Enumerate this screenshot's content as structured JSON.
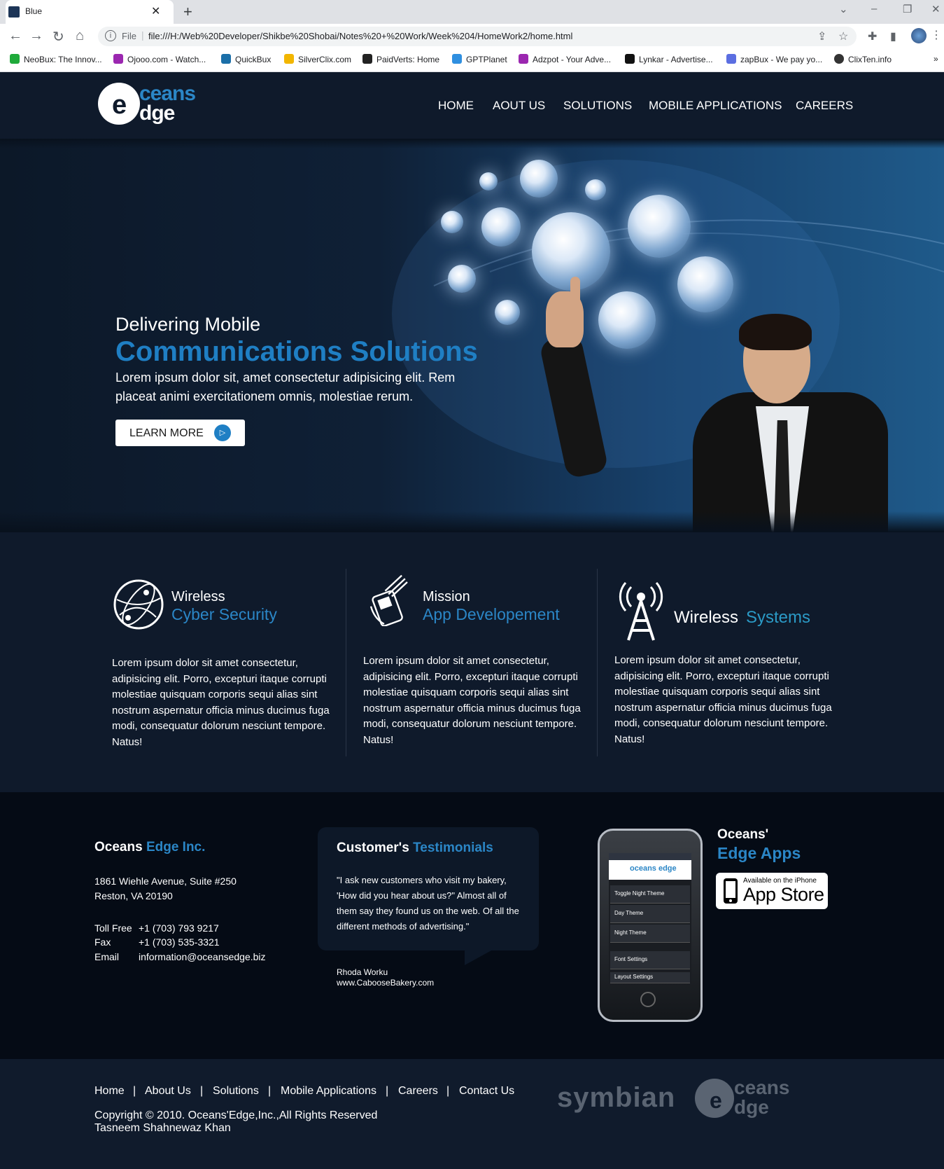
{
  "browser": {
    "tab_title": "Blue",
    "tab_close": "✕",
    "new_tab": "+",
    "url_scheme": "File",
    "url": "file:///H:/Web%20Developer/Shikbe%20Shobai/Notes%20+%20Work/Week%204/HomeWork2/home.html",
    "bookmarks": [
      {
        "label": "NeoBux: The Innov...",
        "color": "#1faa3a"
      },
      {
        "label": "Ojooo.com - Watch...",
        "color": "#9b27b0"
      },
      {
        "label": "QuickBux",
        "color": "#1b6fa8"
      },
      {
        "label": "SilverClix.com",
        "color": "#f2b600"
      },
      {
        "label": "PaidVerts: Home",
        "color": "#222222"
      },
      {
        "label": "GPTPlanet",
        "color": "#2f8fe0"
      },
      {
        "label": "Adzpot - Your Adve...",
        "color": "#9b27b0"
      },
      {
        "label": "Lynkar - Advertise...",
        "color": "#111111"
      },
      {
        "label": "zapBux - We pay yo...",
        "color": "#5b6ee1"
      },
      {
        "label": "ClixTen.info",
        "color": "#333333"
      }
    ],
    "more": "»"
  },
  "logo": {
    "e": "e",
    "oceans": "ceans",
    "edge": "dge"
  },
  "nav": [
    "HOME",
    "AOUT US",
    "SOLUTIONS",
    "MOBILE APPLICATIONS",
    "CAREERS"
  ],
  "hero": {
    "small": "Delivering Mobile",
    "big": "Communications Solutions",
    "body": "Lorem ipsum dolor sit, amet consectetur adipisicing elit. Rem placeat animi exercitationem omnis, molestiae rerum.",
    "button": "LEARN MORE",
    "button_icon": "▷"
  },
  "features": [
    {
      "h1": "Wireless",
      "h2": "Cyber Security",
      "icon": "globe-icon",
      "body": "Lorem ipsum dolor sit amet consectetur, adipisicing elit. Porro, excepturi itaque corrupti molestiae quisquam corporis sequi alias sint nostrum aspernatur officia minus ducimus fuga modi, consequatur dolorum nesciunt tempore. Natus!"
    },
    {
      "h1": "Mission",
      "h2": "App Developement",
      "icon": "phone-hand-icon",
      "body": "Lorem ipsum dolor sit amet consectetur, adipisicing elit. Porro, excepturi itaque corrupti molestiae quisquam corporis sequi alias sint nostrum aspernatur officia minus ducimus fuga modi, consequatur dolorum nesciunt tempore. Natus!"
    },
    {
      "h1": "Wireless",
      "h2": "Systems",
      "icon": "antenna-tower-icon",
      "body": "Lorem ipsum dolor sit amet consectetur, adipisicing elit. Porro, excepturi itaque corrupti molestiae quisquam corporis sequi alias sint nostrum aspernatur officia minus ducimus fuga modi, consequatur dolorum nesciunt tempore. Natus!"
    }
  ],
  "company": {
    "title_white": "Oceans",
    "title_blue": "Edge Inc.",
    "address1": "1861 Wiehle Avenue, Suite #250",
    "address2": "Reston, VA 20190",
    "contacts": [
      {
        "label": "Toll Free",
        "value": "+1 (703) 793 9217"
      },
      {
        "label": "Fax",
        "value": "+1 (703) 535-3321"
      },
      {
        "label": "Email",
        "value": "information@oceansedge.biz"
      }
    ]
  },
  "testimonial": {
    "title_white": "Customer's",
    "title_blue": "Testimonials",
    "quote": "\"I ask new customers who visit my bakery, 'How did you hear about us?\" Almost all of them say they found us on the web. Of all the different methods of advertising.\"",
    "name": "Rhoda Worku",
    "site": "www.CabooseBakery.com"
  },
  "phone_screen": {
    "logo": "oceans edge",
    "rows": [
      "Toggle Night Theme",
      "Day Theme",
      "Night Theme",
      "Font Settings",
      "Layout Settings"
    ]
  },
  "apps": {
    "title_white": "Oceans'",
    "title_blue": "Edge Apps",
    "store_small": "Available on the iPhone",
    "store_big": "App Store"
  },
  "footer": {
    "links": [
      "Home",
      "About Us",
      "Solutions",
      "Mobile Applications",
      "Careers",
      "Contact Us"
    ],
    "separator": "|",
    "copyright": "Copyright © 2010. Oceans'Edge,Inc.,All Rights Reserved",
    "author": "Tasneem Shahnewaz Khan",
    "symbian": "symbian"
  }
}
